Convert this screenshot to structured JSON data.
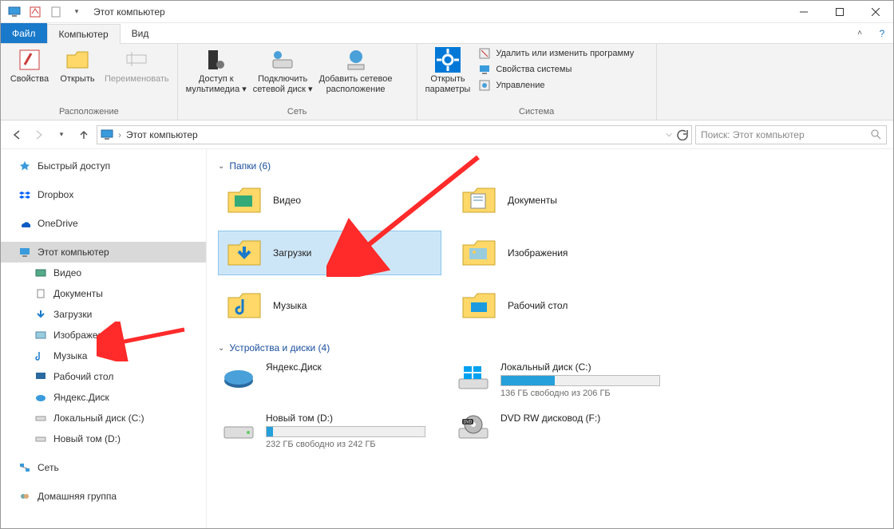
{
  "title": "Этот компьютер",
  "tabs": {
    "file": "Файл",
    "computer": "Компьютер",
    "view": "Вид"
  },
  "ribbon": {
    "group_location": "Расположение",
    "group_network": "Сеть",
    "group_system": "Система",
    "properties": "Свойства",
    "open": "Открыть",
    "rename": "Переименовать",
    "media_access_l1": "Доступ к",
    "media_access_l2": "мультимедиа",
    "map_drive_l1": "Подключить",
    "map_drive_l2": "сетевой диск",
    "add_netloc_l1": "Добавить сетевое",
    "add_netloc_l2": "расположение",
    "open_settings_l1": "Открыть",
    "open_settings_l2": "параметры",
    "uninstall": "Удалить или изменить программу",
    "sys_props": "Свойства системы",
    "manage": "Управление"
  },
  "breadcrumb": {
    "root": "Этот компьютер"
  },
  "search_placeholder": "Поиск: Этот компьютер",
  "sidebar": {
    "quick_access": "Быстрый доступ",
    "dropbox": "Dropbox",
    "onedrive": "OneDrive",
    "this_pc": "Этот компьютер",
    "videos": "Видео",
    "documents": "Документы",
    "downloads": "Загрузки",
    "pictures": "Изображения",
    "music": "Музыка",
    "desktop": "Рабочий стол",
    "yandex_disk": "Яндекс.Диск",
    "local_c": "Локальный диск (C:)",
    "new_vol_d": "Новый том (D:)",
    "network": "Сеть",
    "homegroup": "Домашняя группа"
  },
  "sections": {
    "folders": "Папки (6)",
    "drives": "Устройства и диски (4)"
  },
  "folders": {
    "video": "Видео",
    "documents": "Документы",
    "downloads": "Загрузки",
    "pictures": "Изображения",
    "music": "Музыка",
    "desktop": "Рабочий стол"
  },
  "drives": {
    "yandex": {
      "name": "Яндекс.Диск"
    },
    "local_c": {
      "name": "Локальный диск (C:)",
      "sub": "136 ГБ свободно из 206 ГБ",
      "fill_pct": 34
    },
    "new_d": {
      "name": "Новый том (D:)",
      "sub": "232 ГБ свободно из 242 ГБ",
      "fill_pct": 4
    },
    "dvd": {
      "name": "DVD RW дисковод (F:)"
    }
  },
  "colors": {
    "accent": "#1979ca",
    "selection": "#cde6f7",
    "arrow": "#ff2a2a"
  }
}
